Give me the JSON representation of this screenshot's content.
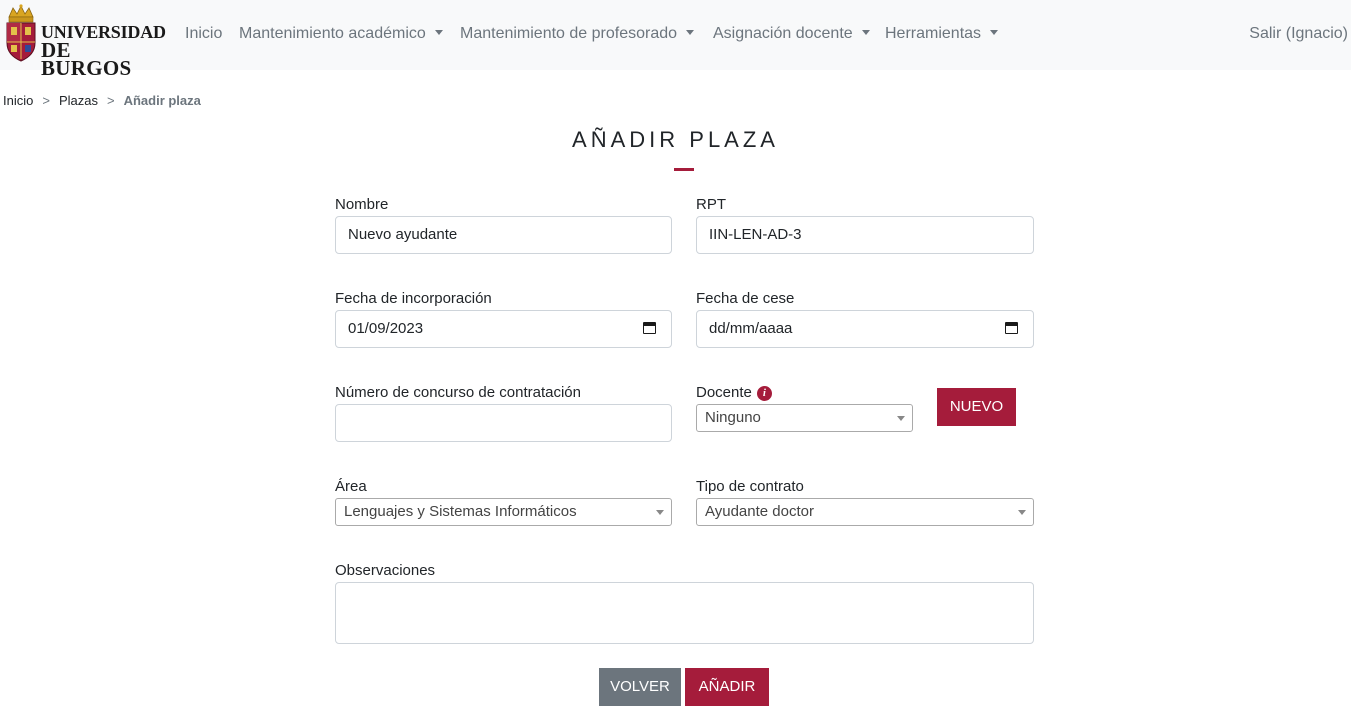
{
  "brand": {
    "logo_line1": "UNIVERSIDAD",
    "logo_line2": "DE BURGOS",
    "accent_color": "#a51c3b",
    "navbar_bg": "#f8f9fa"
  },
  "nav": {
    "items": [
      {
        "label": "Inicio",
        "dropdown": false
      },
      {
        "label": "Mantenimiento académico",
        "dropdown": true
      },
      {
        "label": "Mantenimiento de profesorado",
        "dropdown": true
      },
      {
        "label": "Asignación docente",
        "dropdown": true
      },
      {
        "label": "Herramientas",
        "dropdown": true
      }
    ],
    "logout_label": "Salir (Ignacio)"
  },
  "breadcrumb": {
    "items": [
      "Inicio",
      "Plazas"
    ],
    "separator": ">",
    "current": "Añadir plaza"
  },
  "page": {
    "title": "AÑADIR PLAZA"
  },
  "form": {
    "nombre": {
      "label": "Nombre",
      "value": "Nuevo ayudante"
    },
    "rpt": {
      "label": "RPT",
      "value": "IIN-LEN-AD-3"
    },
    "fecha_incorporacion": {
      "label": "Fecha de incorporación",
      "value": "01/09/2023",
      "icon": "calendar-icon"
    },
    "fecha_cese": {
      "label": "Fecha de cese",
      "value": "dd/mm/aaaa",
      "icon": "calendar-icon"
    },
    "numero_concurso": {
      "label": "Número de concurso de contratación",
      "value": ""
    },
    "docente": {
      "label": "Docente",
      "value": "Ninguno",
      "info_icon": "i",
      "new_button": "NUEVO"
    },
    "area": {
      "label": "Área",
      "value": "Lenguajes y Sistemas Informáticos"
    },
    "tipo_contrato": {
      "label": "Tipo de contrato",
      "value": "Ayudante doctor"
    },
    "observaciones": {
      "label": "Observaciones",
      "value": ""
    }
  },
  "actions": {
    "back_label": "VOLVER",
    "submit_label": "AÑADIR"
  }
}
